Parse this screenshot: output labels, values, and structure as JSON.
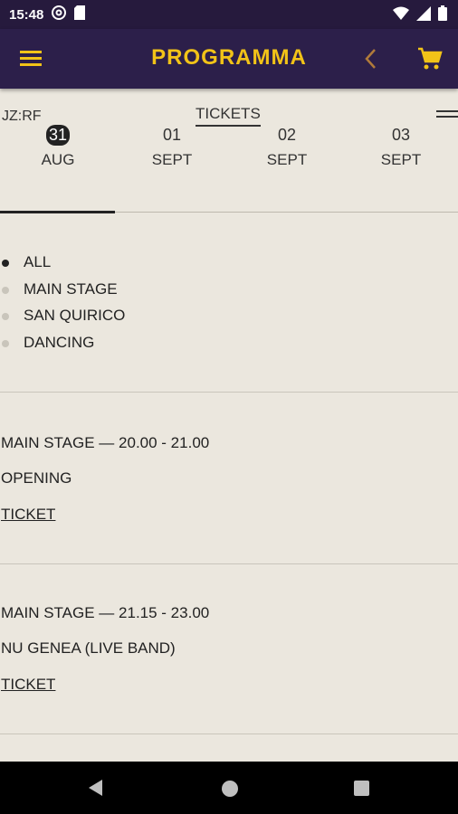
{
  "status": {
    "time": "15:48",
    "icons": [
      "at-sign-icon",
      "sim-card-icon",
      "wifi-icon",
      "signal-icon",
      "battery-icon"
    ]
  },
  "appbar": {
    "title": "PROGRAMMA",
    "icons": [
      "menu-icon",
      "back-chevron-icon",
      "cart-icon"
    ],
    "accent": "#f2c318",
    "background": "#2c1f4a"
  },
  "header": {
    "jz": "JZ:RF",
    "tickets_label": "TICKETS"
  },
  "dates": [
    {
      "num": "31",
      "month": "AUG",
      "active": true
    },
    {
      "num": "01",
      "month": "SEPT",
      "active": false
    },
    {
      "num": "02",
      "month": "SEPT",
      "active": false
    },
    {
      "num": "03",
      "month": "SEPT",
      "active": false
    }
  ],
  "filters": [
    {
      "label": "ALL",
      "active": true
    },
    {
      "label": "MAIN STAGE",
      "active": false
    },
    {
      "label": "SAN QUIRICO",
      "active": false
    },
    {
      "label": "DANCING",
      "active": false
    }
  ],
  "events": [
    {
      "meta": "MAIN STAGE — 20.00 - 21.00",
      "name": "OPENING",
      "ticket": "TICKET"
    },
    {
      "meta": "MAIN STAGE — 21.15 - 23.00",
      "name": "NU GENEA (LIVE BAND)",
      "ticket": "TICKET"
    }
  ]
}
